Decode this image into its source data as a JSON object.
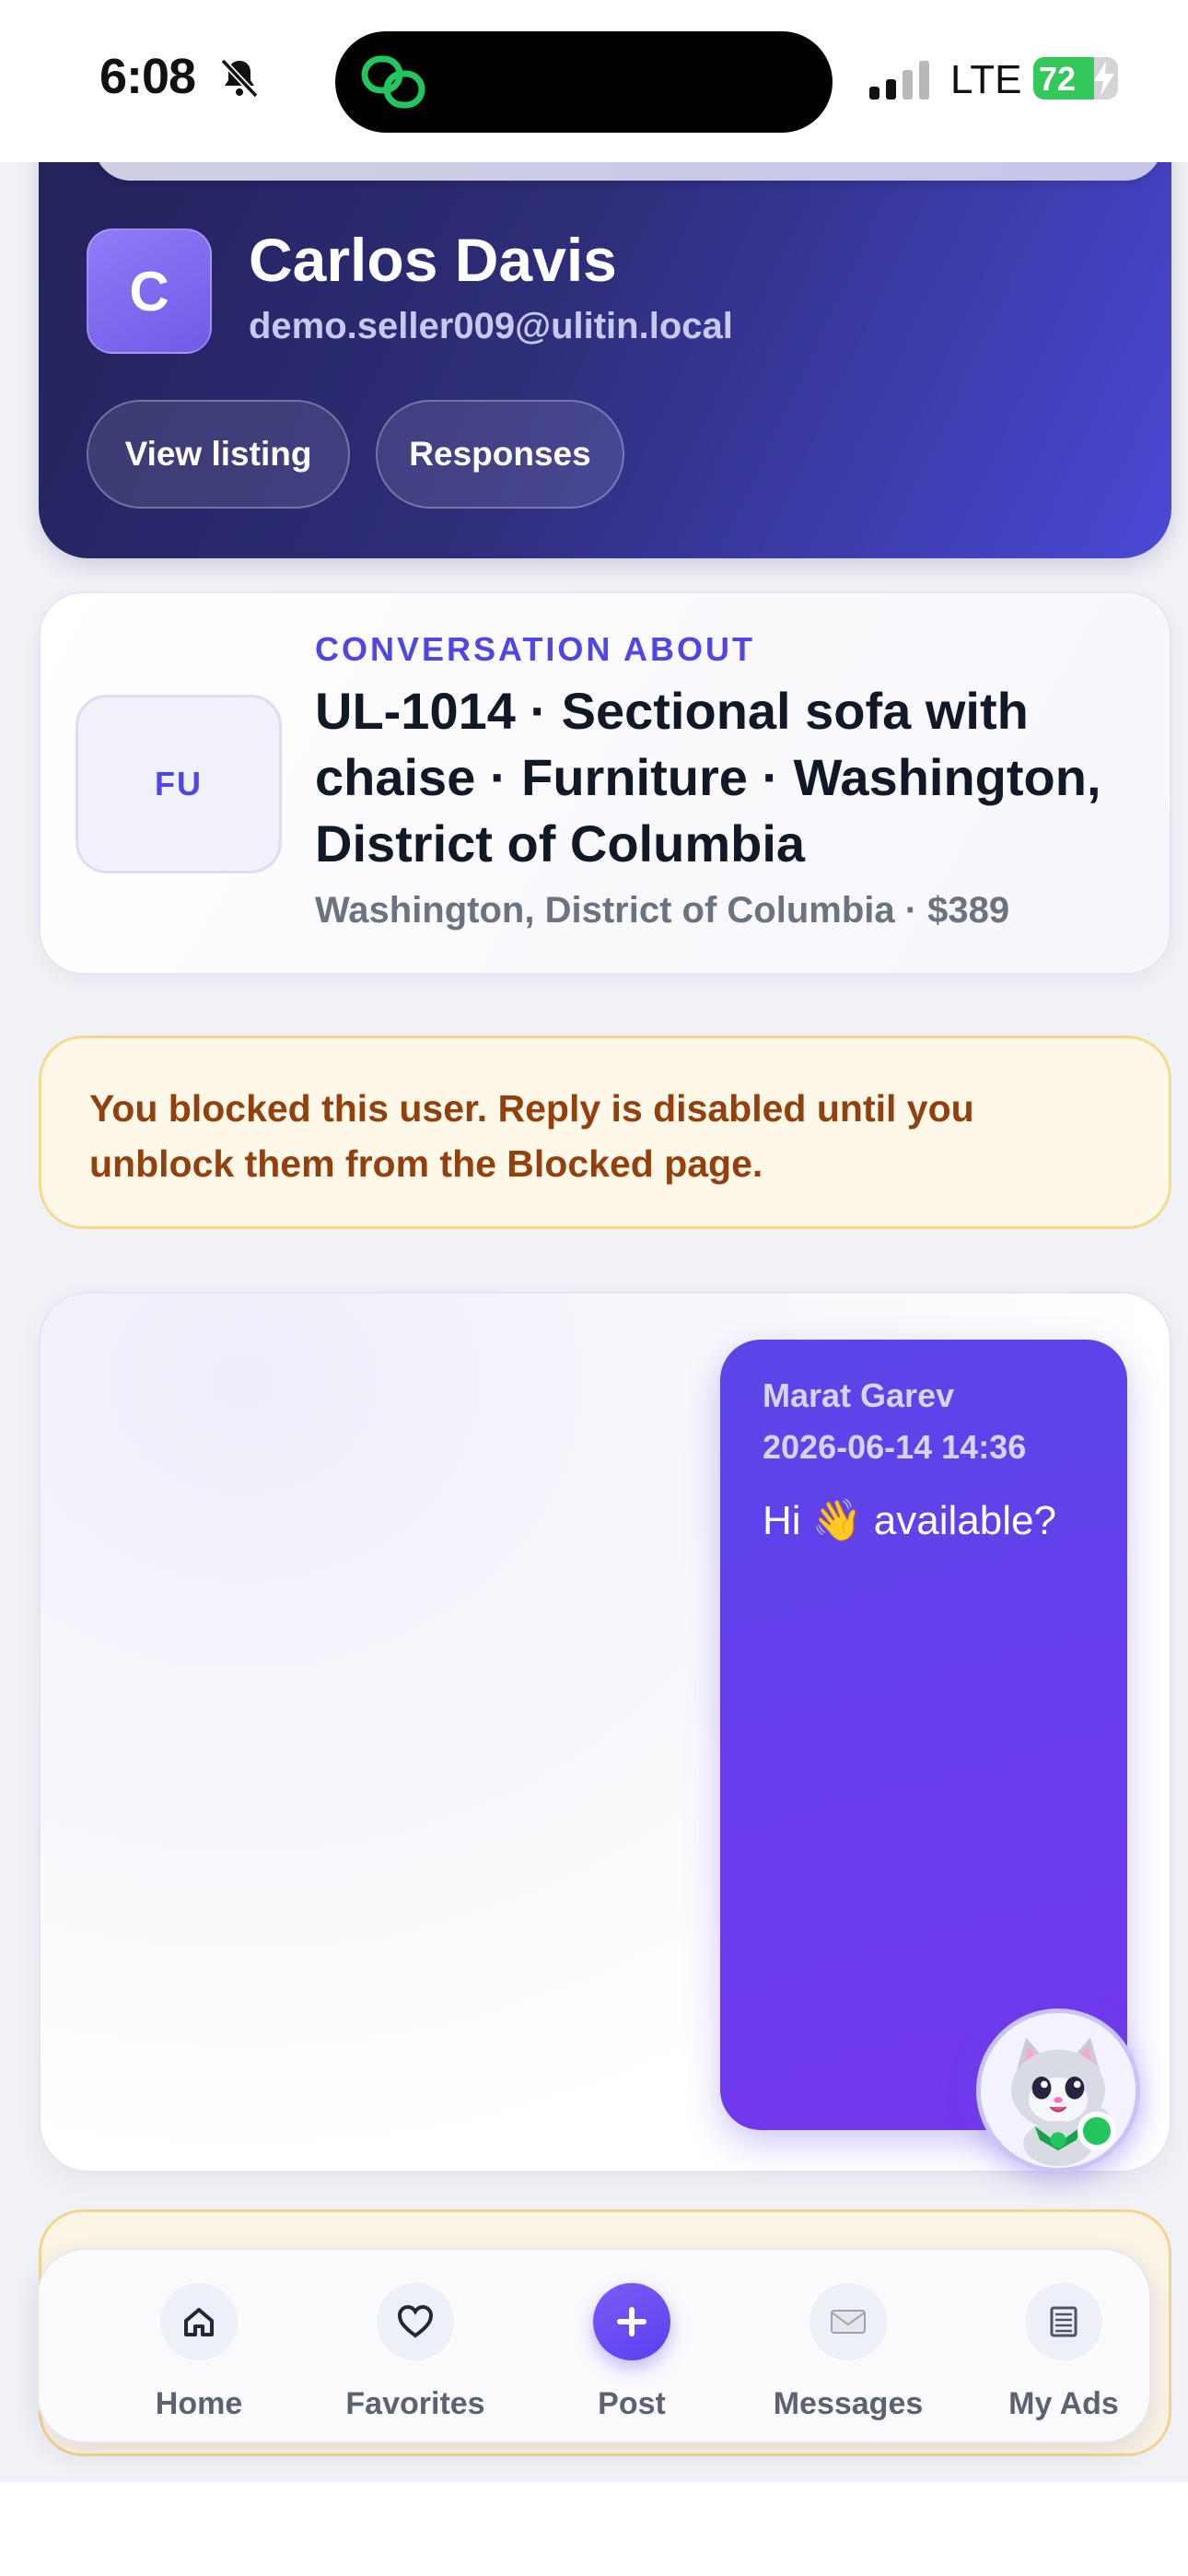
{
  "status_bar": {
    "time": "6:08",
    "network": "LTE",
    "battery_text": "72",
    "battery_level_percent": 72,
    "icons": [
      "bell-slash-icon",
      "chain-link-icon",
      "signal-icon",
      "charging-bolt-icon"
    ]
  },
  "profile": {
    "initial": "C",
    "name": "Carlos Davis",
    "email": "demo.seller009@ulitin.local",
    "view_listing_label": "View listing",
    "responses_label": "Responses"
  },
  "listing": {
    "thumb_label": "FU",
    "kicker": "CONVERSATION ABOUT",
    "title": "UL-1014 · Sectional sofa with chaise · Furniture · Washington, District of Columbia",
    "meta": "Washington, District of Columbia · $389"
  },
  "blocked_banner": {
    "text": "You blocked this user. Reply is disabled until you unblock them from the Blocked page."
  },
  "messages": [
    {
      "sender": "Marat Garev",
      "time": "2026-06-14 14:36",
      "text": "Hi 👋 available?"
    }
  ],
  "mascot": {
    "icon": "cat-mascot-icon",
    "online": true
  },
  "nav": {
    "home": {
      "label": "Home",
      "icon": "home-icon"
    },
    "favorites": {
      "label": "Favorites",
      "icon": "heart-icon"
    },
    "post": {
      "label": "Post",
      "icon": "plus-icon"
    },
    "messages": {
      "label": "Messages",
      "icon": "envelope-icon"
    },
    "my_ads": {
      "label": "My Ads",
      "icon": "list-icon"
    }
  },
  "colors": {
    "accent": "#4f46e5",
    "bubble": "#6a3cee",
    "warning_text": "#92400e",
    "warning_bg": "#fdf8e8",
    "online": "#22c55e"
  }
}
